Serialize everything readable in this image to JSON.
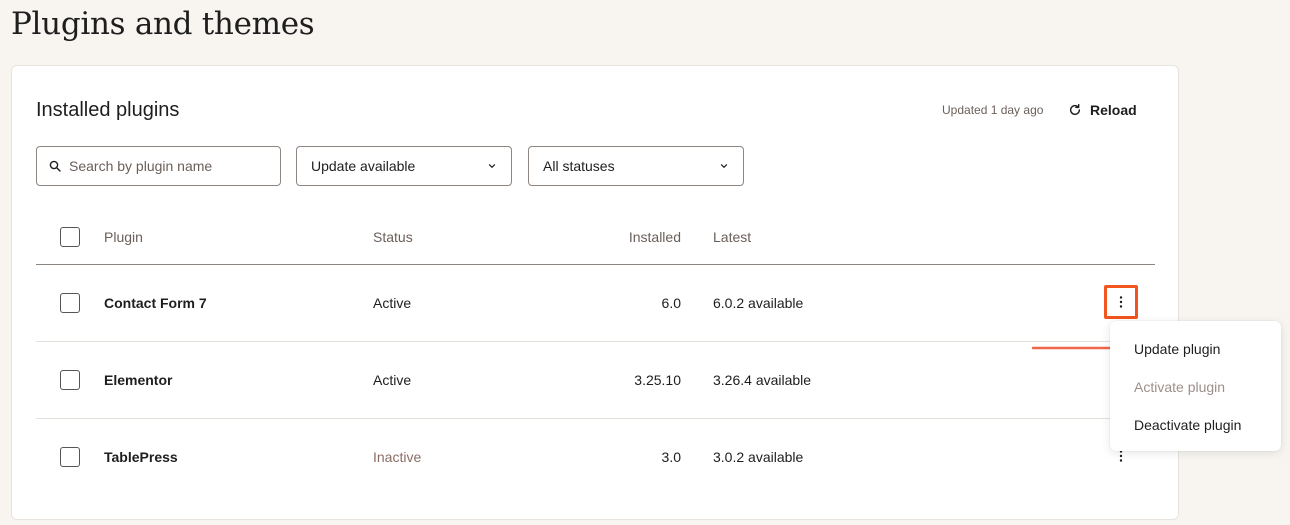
{
  "page": {
    "title": "Plugins and themes"
  },
  "card": {
    "title": "Installed plugins",
    "updated": "Updated 1 day ago",
    "reload_label": "Reload"
  },
  "filters": {
    "search_placeholder": "Search by plugin name",
    "update_filter": "Update available",
    "status_filter": "All statuses"
  },
  "table": {
    "columns": {
      "plugin": "Plugin",
      "status": "Status",
      "installed": "Installed",
      "latest": "Latest"
    },
    "rows": [
      {
        "name": "Contact Form 7",
        "status": "Active",
        "installed": "6.0",
        "latest": "6.0.2 available"
      },
      {
        "name": "Elementor",
        "status": "Active",
        "installed": "3.25.10",
        "latest": "3.26.4 available"
      },
      {
        "name": "TablePress",
        "status": "Inactive",
        "installed": "3.0",
        "latest": "3.0.2 available"
      }
    ]
  },
  "menu": {
    "items": [
      {
        "label": "Update plugin",
        "disabled": false
      },
      {
        "label": "Activate plugin",
        "disabled": true
      },
      {
        "label": "Deactivate plugin",
        "disabled": false
      }
    ]
  },
  "colors": {
    "page_bg": "#f8f5f1",
    "highlight": "#f0561d",
    "arrow": "#f0674a",
    "inactive_text": "#8a6e66",
    "muted_text": "#6b5f5a"
  },
  "icons": {
    "search": "search-icon",
    "reload": "reload-icon",
    "chevron": "chevron-down-icon",
    "more": "more-vertical-icon"
  }
}
